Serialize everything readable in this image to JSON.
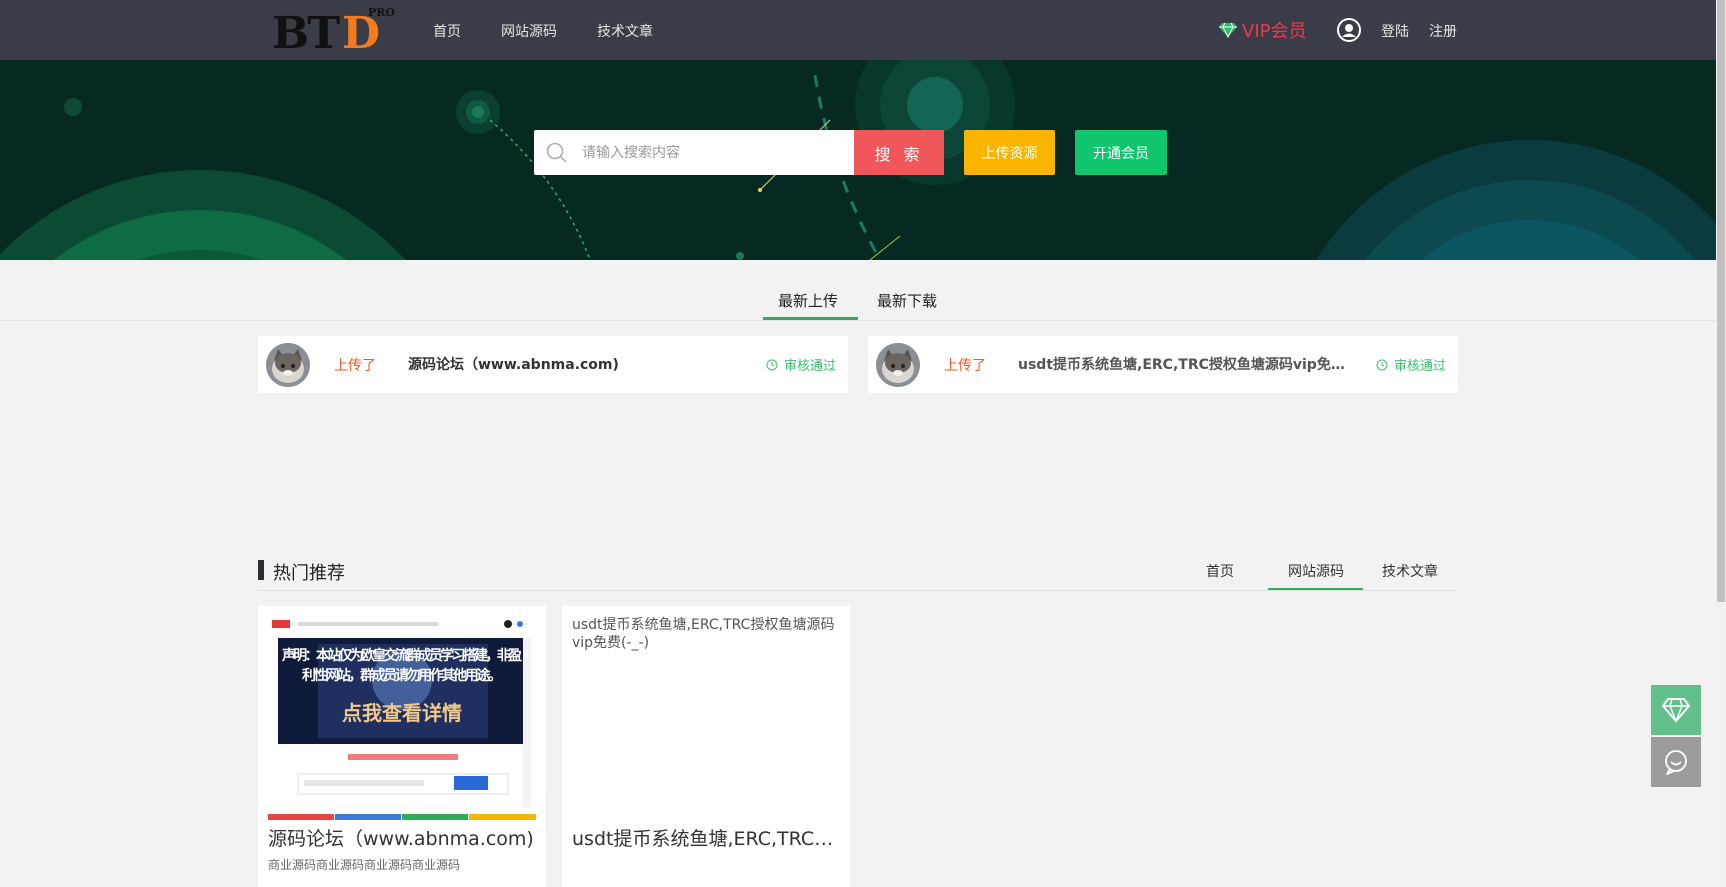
{
  "header": {
    "logo": {
      "main": "BT",
      "accent": "D",
      "sup": "PRO"
    },
    "nav": [
      "首页",
      "网站源码",
      "技术文章"
    ],
    "vip_label": "VIP会员",
    "login": "登陆",
    "register": "注册"
  },
  "banner": {
    "search_placeholder": "请输入搜索内容",
    "search_button": "搜 索",
    "upload_button": "上传资源",
    "member_button": "开通会员"
  },
  "upload_tabs": [
    "最新上传",
    "最新下载"
  ],
  "uploads": [
    {
      "action": "上传了",
      "title": "源码论坛（www.abnma.com)",
      "status": "审核通过"
    },
    {
      "action": "上传了",
      "title": "usdt提币系统鱼塘,ERC,TRC授权鱼塘源码vip免费(-_-)",
      "status": "审核通过"
    }
  ],
  "hot": {
    "title": "热门推荐",
    "tabs": [
      "首页",
      "网站源码",
      "技术文章"
    ],
    "items": [
      {
        "title": "源码论坛（www.abnma.com)",
        "desc": "商业源码商业源码商业源码商业源码",
        "thumb_text": {
          "line1": "声明：本站仅为欧皇交流群成员学习搭建，非盈",
          "line2": "利性网站，群成员请勿用作其他用途。",
          "cta": "点我查看详情"
        }
      },
      {
        "title": "usdt提币系统鱼塘,ERC,TRC授权鱼塘源码vip免费(-_-)",
        "image_alt": "usdt提币系统鱼塘,ERC,TRC授权鱼塘源码vip免费(-_-)",
        "desc": ""
      }
    ]
  },
  "colors": {
    "topbar": "#3a3d47",
    "banner": "#062a22",
    "accent_green": "#2fae5a",
    "search_red": "#f0565a",
    "upload_yellow": "#fbb400",
    "member_green": "#11c56d",
    "vip_red": "#f0374e",
    "uploaded_orange": "#f05a24"
  },
  "icons": [
    "diamond-icon",
    "user-icon",
    "search-icon",
    "clock-icon",
    "chat-icon"
  ]
}
